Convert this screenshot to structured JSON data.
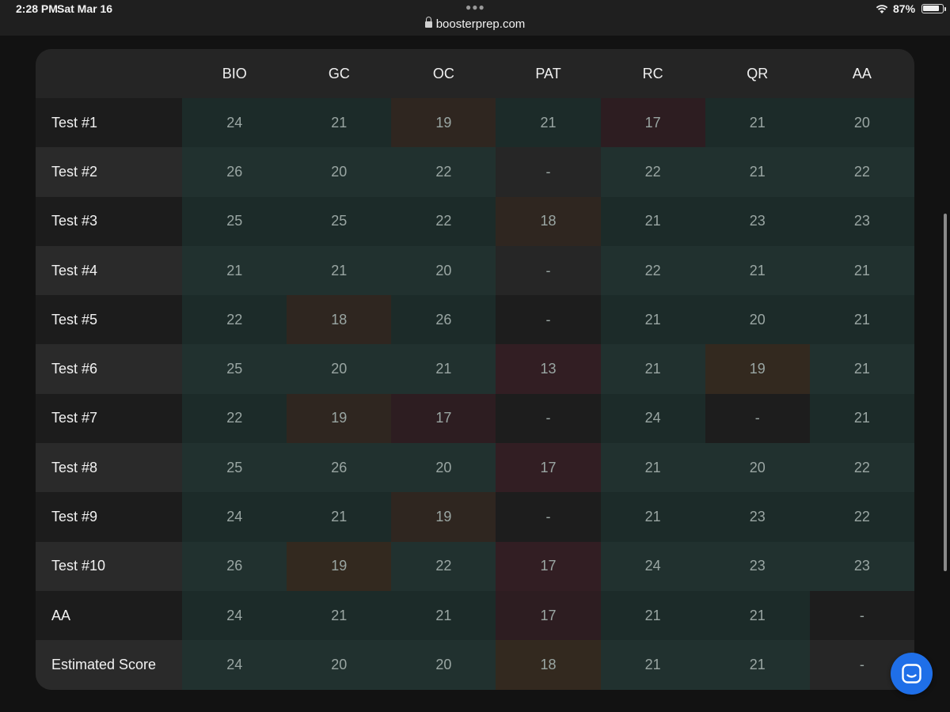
{
  "status_bar": {
    "time": "2:28 PM",
    "date": "Sat Mar 16",
    "url": "boosterprep.com",
    "battery_pct": "87%",
    "battery_level": 0.87
  },
  "table": {
    "columns": [
      "BIO",
      "GC",
      "OC",
      "PAT",
      "RC",
      "QR",
      "AA"
    ],
    "rows": [
      {
        "label": "Test #1",
        "values": [
          "24",
          "21",
          "19",
          "21",
          "17",
          "21",
          "20"
        ],
        "tones": [
          "green",
          "green",
          "orange",
          "green",
          "red",
          "green",
          "green"
        ]
      },
      {
        "label": "Test #2",
        "values": [
          "26",
          "20",
          "22",
          "-",
          "22",
          "21",
          "22"
        ],
        "tones": [
          "green",
          "green",
          "green",
          "none",
          "green",
          "green",
          "green"
        ]
      },
      {
        "label": "Test #3",
        "values": [
          "25",
          "25",
          "22",
          "18",
          "21",
          "23",
          "23"
        ],
        "tones": [
          "green",
          "green",
          "green",
          "orange",
          "green",
          "green",
          "green"
        ]
      },
      {
        "label": "Test #4",
        "values": [
          "21",
          "21",
          "20",
          "-",
          "22",
          "21",
          "21"
        ],
        "tones": [
          "green",
          "green",
          "green",
          "none",
          "green",
          "green",
          "green"
        ]
      },
      {
        "label": "Test #5",
        "values": [
          "22",
          "18",
          "26",
          "-",
          "21",
          "20",
          "21"
        ],
        "tones": [
          "green",
          "orange",
          "green",
          "none",
          "green",
          "green",
          "green"
        ]
      },
      {
        "label": "Test #6",
        "values": [
          "25",
          "20",
          "21",
          "13",
          "21",
          "19",
          "21"
        ],
        "tones": [
          "green",
          "green",
          "green",
          "red",
          "green",
          "orange",
          "green"
        ]
      },
      {
        "label": "Test #7",
        "values": [
          "22",
          "19",
          "17",
          "-",
          "24",
          "-",
          "21"
        ],
        "tones": [
          "green",
          "orange",
          "red",
          "none",
          "green",
          "none",
          "green"
        ]
      },
      {
        "label": "Test #8",
        "values": [
          "25",
          "26",
          "20",
          "17",
          "21",
          "20",
          "22"
        ],
        "tones": [
          "green",
          "green",
          "green",
          "red",
          "green",
          "green",
          "green"
        ]
      },
      {
        "label": "Test #9",
        "values": [
          "24",
          "21",
          "19",
          "-",
          "21",
          "23",
          "22"
        ],
        "tones": [
          "green",
          "green",
          "orange",
          "none",
          "green",
          "green",
          "green"
        ]
      },
      {
        "label": "Test #10",
        "values": [
          "26",
          "19",
          "22",
          "17",
          "24",
          "23",
          "23"
        ],
        "tones": [
          "green",
          "orange",
          "green",
          "red",
          "green",
          "green",
          "green"
        ]
      },
      {
        "label": "AA",
        "values": [
          "24",
          "21",
          "21",
          "17",
          "21",
          "21",
          "-"
        ],
        "tones": [
          "green",
          "green",
          "green",
          "red",
          "green",
          "green",
          "none"
        ]
      },
      {
        "label": "Estimated Score",
        "values": [
          "24",
          "20",
          "20",
          "18",
          "21",
          "21",
          "-"
        ],
        "tones": [
          "green",
          "green",
          "green",
          "orange",
          "green",
          "green",
          "none"
        ]
      }
    ]
  },
  "colors": {
    "accent": "#1f6fe8",
    "green": "#1c2b29",
    "orange": "#2f2620",
    "red": "#2d1d21"
  },
  "chat_button": {
    "icon": "chat-icon"
  }
}
